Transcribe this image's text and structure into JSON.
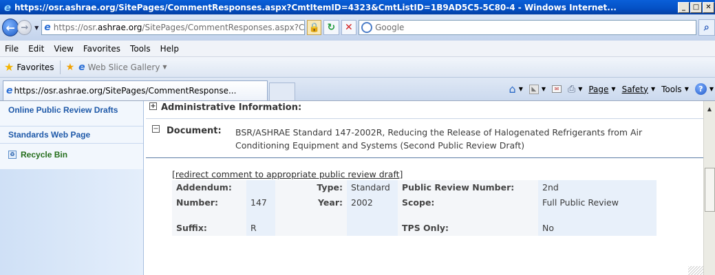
{
  "window": {
    "title": "https://osr.ashrae.org/SitePages/CommentResponses.aspx?CmtItemID=4323&CmtListID=1B9AD5C5-5C80-4 - Windows Internet..."
  },
  "address": {
    "url_prefix": "https://osr.",
    "url_domain": "ashrae.org",
    "url_path": "/SitePages/CommentResponses.aspx?CmtI",
    "search_placeholder": "Google"
  },
  "menu": [
    "File",
    "Edit",
    "View",
    "Favorites",
    "Tools",
    "Help"
  ],
  "favorites": {
    "label": "Favorites",
    "web_slice": "Web Slice Gallery"
  },
  "tab": {
    "label": "https://osr.ashrae.org/SitePages/CommentResponse..."
  },
  "commandbar": {
    "page": "Page",
    "safety": "Safety",
    "tools": "Tools"
  },
  "sidebar": {
    "items": [
      {
        "label": "Online Public Review Drafts"
      },
      {
        "label": "Standards Web Page"
      },
      {
        "label": "Recycle Bin"
      }
    ]
  },
  "main": {
    "admin_heading": "Administrative Information:",
    "document_label": "Document:",
    "document_line1": "BSR/ASHRAE Standard 147-2002R, Reducing the Release of Halogenated Refrigerants from Air",
    "document_line2": "Conditioning Equipment and Systems (Second Public Review Draft)",
    "redirect_link": "[redirect comment to appropriate public review draft]",
    "details": {
      "addendum_label": "Addendum:",
      "addendum_value": "",
      "type_label": "Type:",
      "type_value": "Standard",
      "review_number_label": "Public Review Number:",
      "review_number_value": "2nd",
      "number_label": "Number:",
      "number_value": "147",
      "year_label": "Year:",
      "year_value": "2002",
      "scope_label": "Scope:",
      "scope_value": "Full Public Review",
      "suffix_label": "Suffix:",
      "suffix_value": "R",
      "tps_label": "TPS Only:",
      "tps_value": "No"
    }
  }
}
